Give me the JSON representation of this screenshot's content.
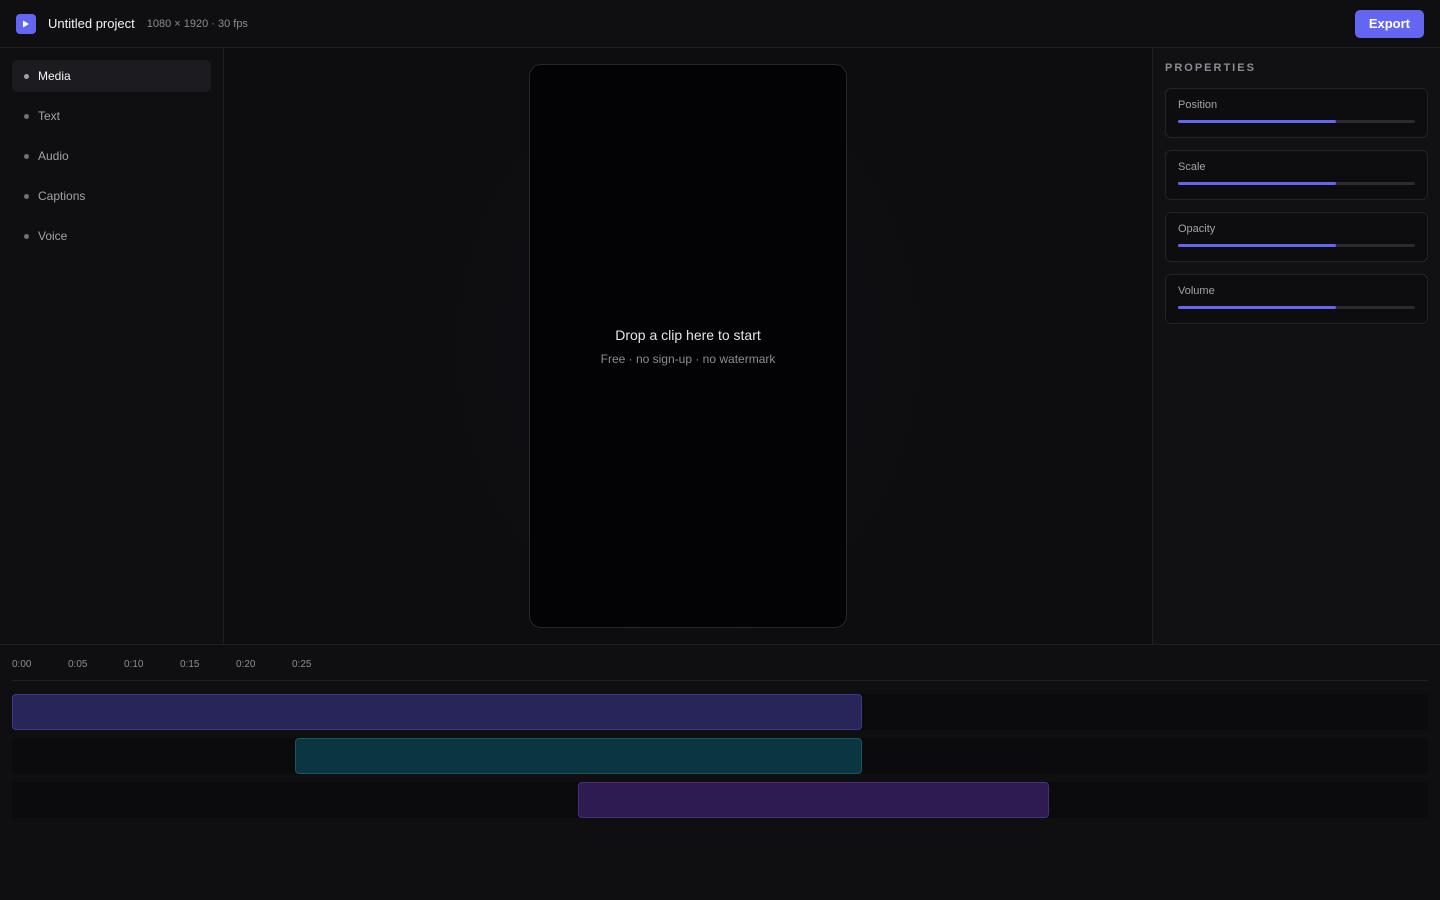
{
  "header": {
    "logo_icon": "play-icon",
    "title": "Untitled project",
    "meta": "1080 × 1920 · 30 fps",
    "export_label": "Export"
  },
  "sidebar": {
    "items": [
      {
        "label": "Media",
        "active": true
      },
      {
        "label": "Text",
        "active": false
      },
      {
        "label": "Audio",
        "active": false
      },
      {
        "label": "Captions",
        "active": false
      },
      {
        "label": "Voice",
        "active": false
      }
    ]
  },
  "canvas": {
    "drop_title": "Drop a clip here to start",
    "drop_subtitle": "Free · no sign-up · no watermark"
  },
  "properties": {
    "title": "PROPERTIES",
    "items": [
      {
        "label": "Position",
        "value": 0.667
      },
      {
        "label": "Scale",
        "value": 0.667
      },
      {
        "label": "Opacity",
        "value": 0.667
      },
      {
        "label": "Volume",
        "value": 0.667
      }
    ]
  },
  "timeline": {
    "ticks": [
      "0:00",
      "0:05",
      "0:10",
      "0:15",
      "0:20",
      "0:25"
    ],
    "tracks": [
      {
        "start_s": 0,
        "end_s": 75.9,
        "color": "#28255a",
        "border": "#3c3a86"
      },
      {
        "start_s": 25.3,
        "end_s": 75.9,
        "color": "#0b3540",
        "border": "#17575e"
      },
      {
        "start_s": 50.5,
        "end_s": 92.6,
        "color": "#2d1b51",
        "border": "#4a2f80"
      }
    ]
  },
  "colors": {
    "accent": "#6366f1",
    "background": "#0f0f11"
  }
}
